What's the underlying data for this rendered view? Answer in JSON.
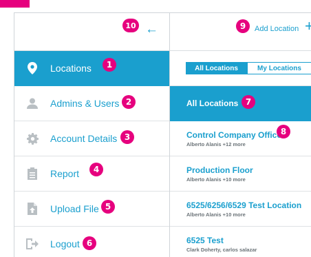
{
  "colors": {
    "accent": "#1a9fce",
    "badge": "#e6007e",
    "icon_gray": "#b9bfc3",
    "text_muted": "#6b7378"
  },
  "sidebar": {
    "back_icon": "arrow-left-icon",
    "items": [
      {
        "label": "Locations",
        "icon": "map-pin-icon",
        "active": true
      },
      {
        "label": "Admins & Users",
        "icon": "user-icon",
        "active": false
      },
      {
        "label": "Account Details",
        "icon": "gear-icon",
        "active": false
      },
      {
        "label": "Report",
        "icon": "clipboard-icon",
        "active": false
      },
      {
        "label": "Upload File",
        "icon": "upload-file-icon",
        "active": false
      },
      {
        "label": "Logout",
        "icon": "logout-icon",
        "active": false
      }
    ]
  },
  "main": {
    "add_location_label": "Add Location",
    "add_icon": "plus-icon",
    "filter": {
      "all_label": "All Locations",
      "my_label": "My Locations",
      "selected": "All Locations"
    },
    "list_header": "All Locations",
    "locations": [
      {
        "name": "Control Company Office",
        "people": "Alberto Alanis +12 more"
      },
      {
        "name": "Production Floor",
        "people": "Alberto Alanis +10 more"
      },
      {
        "name": "6525/6256/6529 Test Location",
        "people": "Alberto Alanis +10 more"
      },
      {
        "name": "6525 Test",
        "people": "Clark Doherty, carlos salazar"
      }
    ]
  },
  "annotations": [
    "1",
    "2",
    "3",
    "4",
    "5",
    "6",
    "7",
    "8",
    "9",
    "10"
  ]
}
